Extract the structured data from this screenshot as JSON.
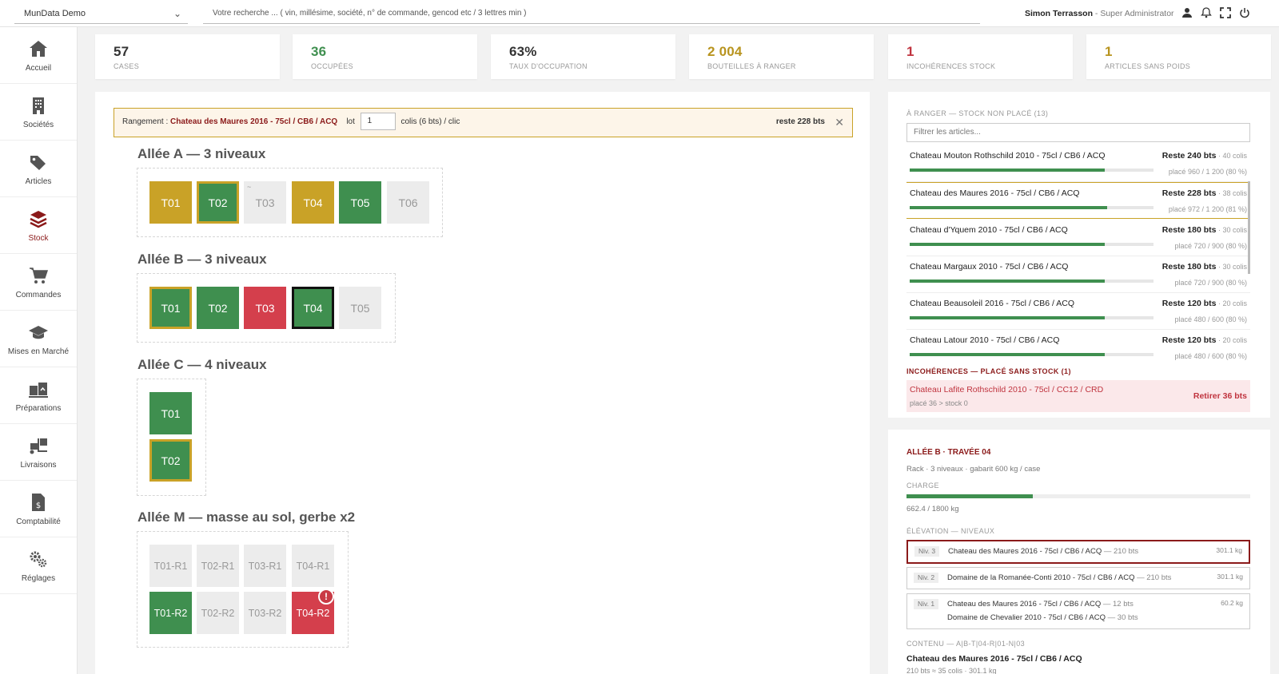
{
  "topbar": {
    "company": "MunData Demo",
    "search_placeholder": "Votre recherche ... ( vin, millésime, société, n° de commande, gencod etc / 3 lettres min )",
    "user_name": "Simon Terrasson",
    "user_role": " - Super Administrator"
  },
  "sidebar": {
    "items": [
      {
        "label": "Accueil",
        "icon": "home-icon"
      },
      {
        "label": "Sociétés",
        "icon": "building-icon"
      },
      {
        "label": "Articles",
        "icon": "tags-icon"
      },
      {
        "label": "Stock",
        "icon": "layers-icon"
      },
      {
        "label": "Commandes",
        "icon": "cart-icon"
      },
      {
        "label": "Mises en Marché",
        "icon": "graduation-cap-icon"
      },
      {
        "label": "Préparations",
        "icon": "pallet-icon"
      },
      {
        "label": "Livraisons",
        "icon": "forklift-icon"
      },
      {
        "label": "Comptabilité",
        "icon": "invoice-icon"
      },
      {
        "label": "Réglages",
        "icon": "gears-icon"
      }
    ],
    "active": "Stock"
  },
  "kpis": [
    {
      "value": "57",
      "label": "CASES",
      "color": "#222222"
    },
    {
      "value": "36",
      "label": "OCCUPÉES",
      "color": "#3f8f4f"
    },
    {
      "value": "63%",
      "label": "TAUX D'OCCUPATION",
      "color": "#222222"
    },
    {
      "value": "2 004",
      "label": "BOUTEILLES À RANGER",
      "color": "#b8941f"
    },
    {
      "value": "1",
      "label": "INCOHÉRENCES STOCK",
      "color": "#c0343f"
    },
    {
      "value": "1",
      "label": "ARTICLES SANS POIDS",
      "color": "#b8941f"
    }
  ],
  "rangement": {
    "label": "Rangement : ",
    "product": "Chateau des Maures 2016 - 75cl / CB6 / ACQ",
    "lot_label": "lot",
    "lot_value": "1",
    "suffix": "colis (6 bts) / clic",
    "reste": "reste 228 bts",
    "close": "✕"
  },
  "aisles": {
    "a": {
      "title": "Allée A — 3 niveaux",
      "bays": [
        "T01",
        "T02",
        "T03",
        "T04",
        "T05",
        "T06"
      ]
    },
    "b": {
      "title": "Allée B — 3 niveaux",
      "bays": [
        "T01",
        "T02",
        "T03",
        "T04",
        "T05"
      ]
    },
    "c": {
      "title": "Allée C — 4 niveaux",
      "bays": [
        "T01",
        "T02"
      ]
    },
    "m": {
      "title": "Allée M — masse au sol, gerbe x2",
      "bays": [
        "T01-R1",
        "T02-R1",
        "T03-R1",
        "T04-R1",
        "T01-R2",
        "T02-R2",
        "T03-R2",
        "T04-R2"
      ]
    }
  },
  "colors": {
    "green": "#3f8f4f",
    "gold": "#c9a227",
    "red": "#d43f4c",
    "empty": "#ececec",
    "brand": "#8b1a1a"
  },
  "a_ranger": {
    "title": "À RANGER — STOCK NON PLACÉ (13)",
    "filter_placeholder": "Filtrer les articles...",
    "items": [
      {
        "name": "Chateau Mouton Rothschild 2010 - 75cl / CB6 / ACQ",
        "reste": "Reste 240 bts",
        "colis": " · 40 colis",
        "place": "placé 960 / 1 200 (80 %)",
        "progress": 0.8
      },
      {
        "name": "Chateau des Maures 2016 - 75cl / CB6 / ACQ",
        "reste": "Reste 228 bts",
        "colis": " · 38 colis",
        "place": "placé 972 / 1 200 (81 %)",
        "progress": 0.81
      },
      {
        "name": "Chateau d'Yquem 2010 - 75cl / CB6 / ACQ",
        "reste": "Reste 180 bts",
        "colis": " · 30 colis",
        "place": "placé 720 / 900 (80 %)",
        "progress": 0.8
      },
      {
        "name": "Chateau Margaux 2010 - 75cl / CB6 / ACQ",
        "reste": "Reste 180 bts",
        "colis": " · 30 colis",
        "place": "placé 720 / 900 (80 %)",
        "progress": 0.8
      },
      {
        "name": "Chateau Beausoleil 2016 - 75cl / CB6 / ACQ",
        "reste": "Reste 120 bts",
        "colis": " · 20 colis",
        "place": "placé 480 / 600 (80 %)",
        "progress": 0.8
      },
      {
        "name": "Chateau Latour 2010 - 75cl / CB6 / ACQ",
        "reste": "Reste 120 bts",
        "colis": " · 20 colis",
        "place": "placé 480 / 600 (80 %)",
        "progress": 0.8
      }
    ]
  },
  "incoherences": {
    "title": "INCOHÉRENCES — PLACÉ SANS STOCK (1)",
    "name": "Chateau Lafite Rothschild 2010 - 75cl / CC12 / CRD",
    "sub": "placé 36 > stock 0",
    "action": "Retirer 36 bts"
  },
  "detail": {
    "title": "ALLÉE B · TRAVÉE 04",
    "sub": "Rack · 3 niveaux · gabarit 600 kg / case",
    "charge_label": "CHARGE",
    "charge_value": "662.4 / 1800 kg",
    "charge_fraction": 0.368,
    "elevation_label": "ÉLÉVATION — NIVEAUX",
    "levels": [
      {
        "tag": "Niv. 3",
        "lines": [
          {
            "name": "Chateau des Maures 2016 - 75cl / CB6 / ACQ",
            "qty": " — 210 bts"
          }
        ],
        "kg": "301.1 kg"
      },
      {
        "tag": "Niv. 2",
        "lines": [
          {
            "name": "Domaine de la Romanée-Conti 2010 - 75cl / CB6 / ACQ",
            "qty": " — 210 bts"
          }
        ],
        "kg": "301.1 kg"
      },
      {
        "tag": "Niv. 1",
        "lines": [
          {
            "name": "Chateau des Maures 2016 - 75cl / CB6 / ACQ",
            "qty": " — 12 bts"
          },
          {
            "name": "Domaine de Chevalier 2010 - 75cl / CB6 / ACQ",
            "qty": " — 30 bts"
          }
        ],
        "kg": "60.2 kg"
      }
    ],
    "contenu_label": "CONTENU — A|B-T|04-R|01-N|03",
    "contenu_name": "Chateau des Maures 2016 - 75cl / CB6 / ACQ",
    "contenu_sub": "210 bts ≈ 35 colis · 301.1 kg"
  }
}
